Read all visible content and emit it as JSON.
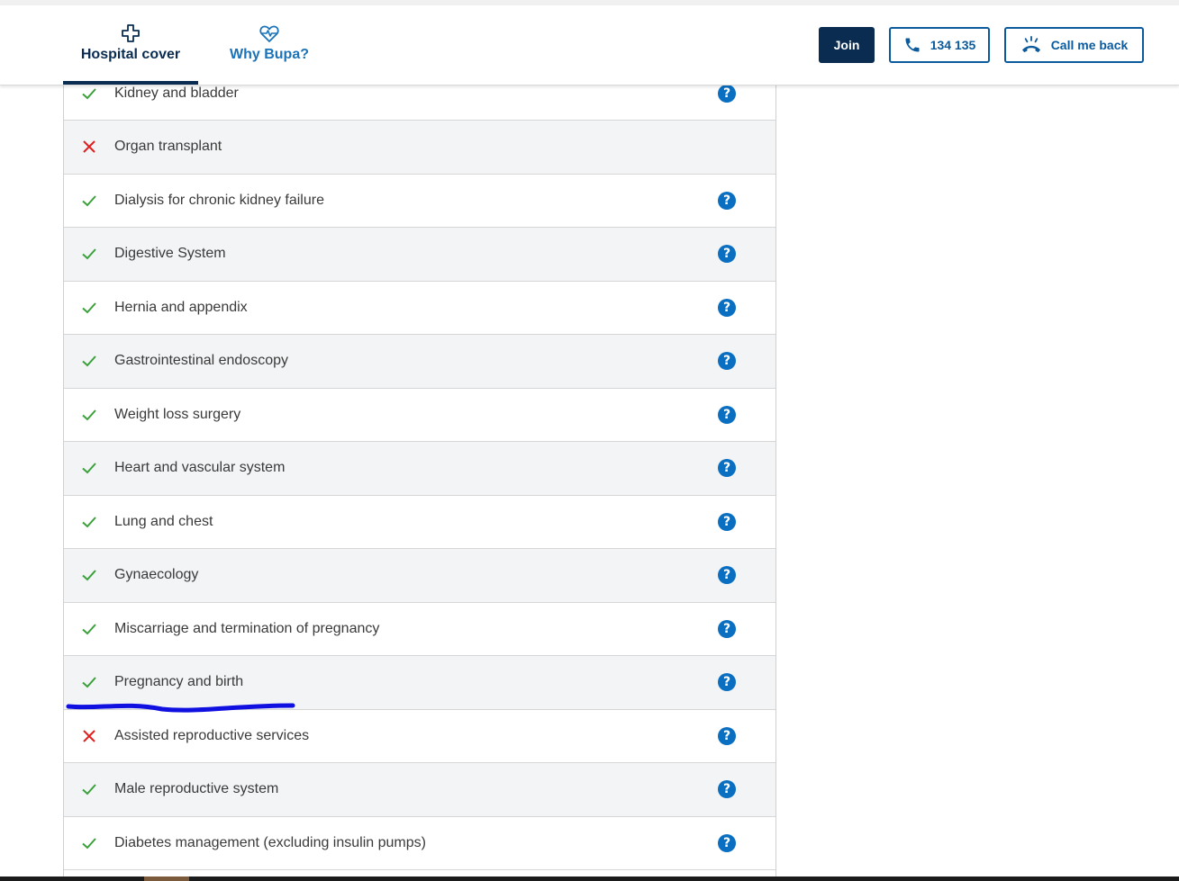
{
  "header": {
    "tabs": [
      {
        "label": "Hospital cover",
        "icon": "medical-cross-icon",
        "active": true
      },
      {
        "label": "Why Bupa?",
        "icon": "heart-pulse-icon",
        "active": false
      }
    ],
    "join_label": "Join",
    "phone_label": "134 135",
    "callback_label": "Call me back",
    "colors": {
      "navy": "#0a2c51",
      "blue": "#0a5a9c",
      "help": "#0a6fc1",
      "check": "#3aa13a",
      "cross": "#e02020"
    }
  },
  "cover_list": [
    {
      "label": "Kidney and bladder",
      "covered": true,
      "help": true
    },
    {
      "label": "Organ transplant",
      "covered": false,
      "help": false
    },
    {
      "label": "Dialysis for chronic kidney failure",
      "covered": true,
      "help": true
    },
    {
      "label": "Digestive System",
      "covered": true,
      "help": true
    },
    {
      "label": "Hernia and appendix",
      "covered": true,
      "help": true
    },
    {
      "label": "Gastrointestinal endoscopy",
      "covered": true,
      "help": true
    },
    {
      "label": "Weight loss surgery",
      "covered": true,
      "help": true
    },
    {
      "label": "Heart and vascular system",
      "covered": true,
      "help": true
    },
    {
      "label": "Lung and chest",
      "covered": true,
      "help": true
    },
    {
      "label": "Gynaecology",
      "covered": true,
      "help": true
    },
    {
      "label": "Miscarriage and termination of pregnancy",
      "covered": true,
      "help": true
    },
    {
      "label": "Pregnancy and birth",
      "covered": true,
      "help": true
    },
    {
      "label": "Assisted reproductive services",
      "covered": false,
      "help": true
    },
    {
      "label": "Male reproductive system",
      "covered": true,
      "help": true
    },
    {
      "label": "Diabetes management (excluding insulin pumps)",
      "covered": true,
      "help": true
    }
  ],
  "help_glyph": "?"
}
